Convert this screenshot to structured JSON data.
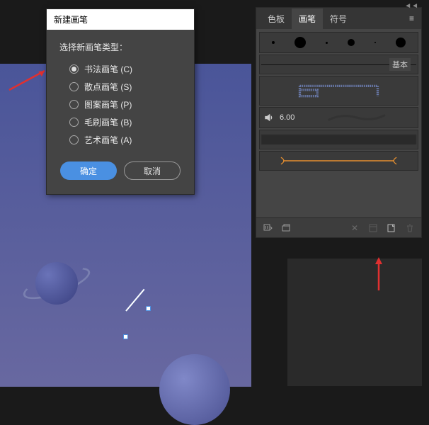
{
  "dialog": {
    "title": "新建画笔",
    "type_label": "选择新画笔类型：",
    "options": [
      {
        "label": "书法画笔 (C)",
        "checked": true
      },
      {
        "label": "散点画笔 (S)",
        "checked": false
      },
      {
        "label": "图案画笔 (P)",
        "checked": false
      },
      {
        "label": "毛刷画笔 (B)",
        "checked": false
      },
      {
        "label": "艺术画笔 (A)",
        "checked": false
      }
    ],
    "ok": "确定",
    "cancel": "取消"
  },
  "panel": {
    "tabs": [
      {
        "label": "色板",
        "active": false
      },
      {
        "label": "画笔",
        "active": true
      },
      {
        "label": "符号",
        "active": false
      }
    ],
    "basic_label": "基本",
    "brush_size": "6.00"
  }
}
